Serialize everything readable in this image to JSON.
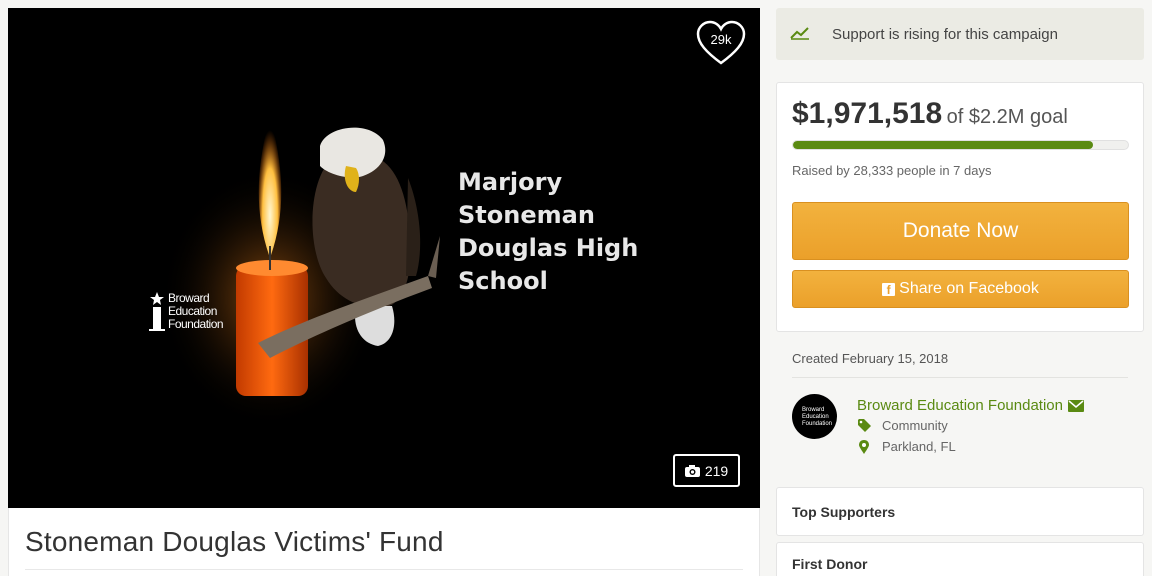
{
  "hero": {
    "heart_count": "29k",
    "photo_count": "219",
    "image_text_lines": [
      "Marjory",
      "Stoneman",
      "Douglas High",
      "School"
    ],
    "logo_lines": [
      "Broward",
      "Education",
      "Foundation"
    ]
  },
  "campaign": {
    "title": "Stoneman Douglas Victims' Fund"
  },
  "rising": {
    "text": "Support is rising for this campaign"
  },
  "funding": {
    "raised": "$1,971,518",
    "goal_text": "of $2.2M goal",
    "progress_fraction": 0.896,
    "raised_by": "Raised by 28,333 people in 7 days",
    "donate_label": "Donate Now",
    "share_label": "Share on Facebook"
  },
  "meta": {
    "created": "Created February 15, 2018"
  },
  "organizer": {
    "avatar_lines": [
      "Broward",
      "Education",
      "Foundation"
    ],
    "name": "Broward Education Foundation",
    "category": "Community",
    "location": "Parkland, FL"
  },
  "sections": {
    "top_supporters": "Top Supporters",
    "first_donor": "First Donor"
  },
  "colors": {
    "accent_green": "#5a8a12",
    "donate_orange": "#eba02a"
  }
}
